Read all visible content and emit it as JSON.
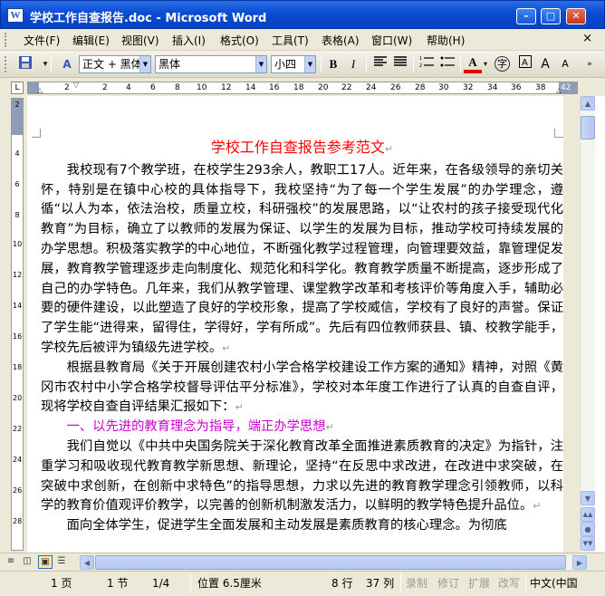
{
  "window": {
    "title": "学校工作自查报告.doc - Microsoft Word",
    "app_icon": "W"
  },
  "menu": [
    "文件(F)",
    "编辑(E)",
    "视图(V)",
    "插入(I)",
    "格式(O)",
    "工具(T)",
    "表格(A)",
    "窗口(W)",
    "帮助(H)"
  ],
  "toolbar": {
    "style_value": "正文 + 黑体",
    "font_value": "黑体",
    "size_value": "小四",
    "bold": "B",
    "italic": "I",
    "font_color_label": "A",
    "phonetic": "字",
    "grow_font": "A",
    "shrink_font": "A"
  },
  "ruler": {
    "labels": [
      "2",
      "2",
      "4",
      "6",
      "8",
      "10",
      "12",
      "14",
      "16",
      "18",
      "20",
      "22",
      "24",
      "26",
      "28",
      "30",
      "32",
      "34",
      "36",
      "38",
      "40",
      "42"
    ],
    "vlabels": [
      "2",
      "4",
      "6",
      "8",
      "10",
      "12",
      "14",
      "16",
      "18",
      "20",
      "22",
      "24",
      "26",
      "28"
    ]
  },
  "document": {
    "title": "学校工作自查报告参考范文",
    "p1": "我校现有7个教学班，在校学生293余人，教职工17人。近年来，在各级领导的亲切关怀，特别是在镇中心校的具体指导下，我校坚持“为了每一个学生发展”的办学理念，遵循“以人为本，依法治校，质量立校，科研强校”的发展思路，以“让农村的孩子接受现代化教育”为目标，确立了以教师的发展为保证、以学生的发展为目标，推动学校可持续发展的办学思想。积极落实教学的中心地位，不断强化教学过程管理，向管理要效益，靠管理促发展，教育教学管理逐步走向制度化、规范化和科学化。教育教学质量不断提高，逐步形成了自己的办学特色。几年来，我们从教学管理、课堂教学改革和考核评价等角度入手，辅助必要的硬件建设，以此塑造了良好的学校形象，提高了学校威信，学校有了良好的声誉。保证了学生能“进得来，留得住，学得好，学有所成”。先后有四位教师获县、镇、校教学能手，学校先后被评为镇级先进学校。",
    "p2": "根据县教育局《关于开展创建农村小学合格学校建设工作方案的通知》精神，对照《黄冈市农村中小学合格学校督导评估平分标准》，学校对本年度工作进行了认真的自查自评，现将学校自查自评结果汇报如下：",
    "h1": "一、以先进的教育理念为指导，端正办学思想",
    "p3": "我们自觉以《中共中央国务院关于深化教育改革全面推进素质教育的决定》为指针，注重学习和吸收现代教育教学新思想、新理论，坚持“在反思中求改进，在改进中求突破，在突破中求创新，在创新中求特色”的指导思想，力求以先进的教育教学理念引领教师，以科学的教育价值观评价教学，以完善的创新机制激发活力，以鲜明的教学特色提升品位。",
    "p4": "面向全体学生，促进学生全面发展和主动发展是素质教育的核心理念。为彻底"
  },
  "status": {
    "page": "1 页",
    "section": "1 节",
    "page_of": "1/4",
    "position": "位置 6.5厘米",
    "line": "8 行",
    "col": "37 列",
    "rec": "录制",
    "trk": "修订",
    "ext": "扩展",
    "ovr": "改写",
    "lang": "中文(中国"
  }
}
